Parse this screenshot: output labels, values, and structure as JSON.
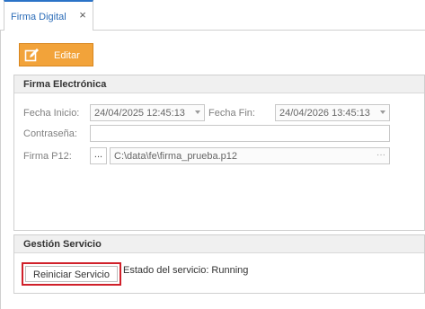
{
  "tabs": [
    {
      "label": "Firma Digital",
      "close_symbol": "×"
    }
  ],
  "toolbar": {
    "edit_label": "Editar",
    "edit_icon": "edit-icon",
    "accent": "#f2a33a"
  },
  "signature_group": {
    "title": "Firma Electrónica",
    "start_date_label": "Fecha Inicio:",
    "start_date_value": "24/04/2025 12:45:13",
    "end_date_label": "Fecha Fin:",
    "end_date_value": "24/04/2026 13:45:13",
    "password_label": "Contraseña:",
    "password_value": "",
    "p12_label": "Firma P12:",
    "browse_label": "...",
    "p12_path": "C:\\data\\fe\\firma_prueba.p12",
    "p12_more": "···"
  },
  "service_group": {
    "title": "Gestión Servicio",
    "restart_label": "Reiniciar Servicio",
    "status_text": "Estado del servicio: Running",
    "highlight_color": "#d0202a"
  }
}
